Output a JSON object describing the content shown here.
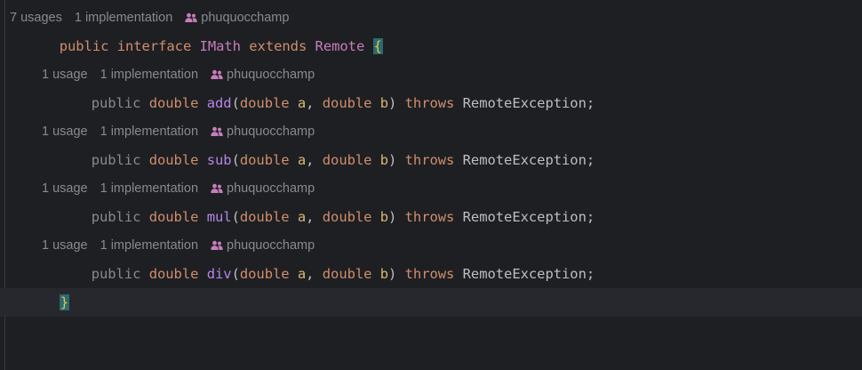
{
  "interface_hints": {
    "usages": "7 usages",
    "implementations": "1 implementation",
    "author": "phuquocchamp"
  },
  "interface_decl": {
    "public": "public",
    "interface": "interface",
    "name": "IMath",
    "extends": "extends",
    "parent": "Remote",
    "open_brace": "{"
  },
  "methods": [
    {
      "hints": {
        "usages": "1 usage",
        "implementations": "1 implementation",
        "author": "phuquocchamp"
      },
      "public": "public",
      "return_type": "double",
      "name": "add",
      "open_paren": "(",
      "p1_type": "double",
      "p1_name": "a",
      "comma": ",",
      "p2_type": "double",
      "p2_name": "b",
      "close_paren": ")",
      "throws": "throws",
      "exception": "RemoteException",
      "semicolon": ";"
    },
    {
      "hints": {
        "usages": "1 usage",
        "implementations": "1 implementation",
        "author": "phuquocchamp"
      },
      "public": "public",
      "return_type": "double",
      "name": "sub",
      "open_paren": "(",
      "p1_type": "double",
      "p1_name": "a",
      "comma": ",",
      "p2_type": "double",
      "p2_name": "b",
      "close_paren": ")",
      "throws": "throws",
      "exception": "RemoteException",
      "semicolon": ";"
    },
    {
      "hints": {
        "usages": "1 usage",
        "implementations": "1 implementation",
        "author": "phuquocchamp"
      },
      "public": "public",
      "return_type": "double",
      "name": "mul",
      "open_paren": "(",
      "p1_type": "double",
      "p1_name": "a",
      "comma": ",",
      "p2_type": "double",
      "p2_name": "b",
      "close_paren": ")",
      "throws": "throws",
      "exception": "RemoteException",
      "semicolon": ";"
    },
    {
      "hints": {
        "usages": "1 usage",
        "implementations": "1 implementation",
        "author": "phuquocchamp"
      },
      "public": "public",
      "return_type": "double",
      "name": "div",
      "open_paren": "(",
      "p1_type": "double",
      "p1_name": "a",
      "comma": ",",
      "p2_type": "double",
      "p2_name": "b",
      "close_paren": ")",
      "throws": "throws",
      "exception": "RemoteException",
      "semicolon": ";"
    }
  ],
  "close_brace": "}",
  "colors": {
    "background": "#1e1f22",
    "keyword": "#cf8e6d",
    "method": "#b586e5",
    "class_name": "#c77dbb",
    "parameter": "#d5b778",
    "hint_text": "#868a91",
    "author_icon": "#c77dbb",
    "brace_highlight": "#2b6a6e"
  },
  "icons": {
    "author": "people-icon"
  }
}
